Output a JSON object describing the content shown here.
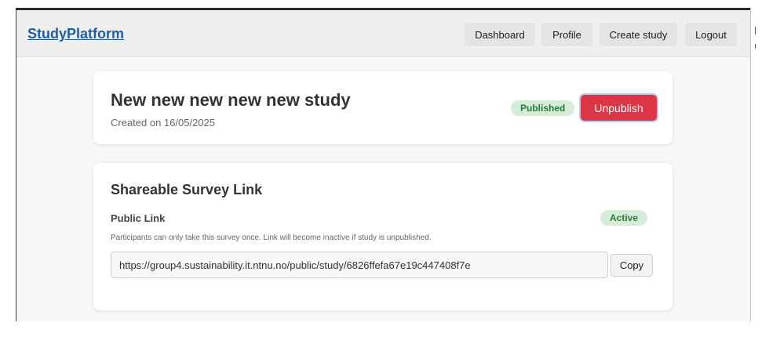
{
  "navbar": {
    "brand": "StudyPlatform",
    "buttons": {
      "dashboard": "Dashboard",
      "profile": "Profile",
      "create_study": "Create study",
      "logout": "Logout"
    }
  },
  "study": {
    "title": "New new new new new study",
    "created": "Created on 16/05/2025",
    "status_badge": "Published",
    "unpublish_label": "Unpublish"
  },
  "share": {
    "heading": "Shareable Survey Link",
    "public_link_label": "Public Link",
    "link_status": "Active",
    "note": "Participants can only take this survey once. Link will become inactive if study is unpublished.",
    "url": "https://group4.sustainability.it.ntnu.no/public/study/6826ffefa67e19c447408f7e",
    "copy_label": "Copy"
  },
  "colors": {
    "brand": "#1f5fa8",
    "danger": "#dc3545",
    "success_bg": "#d5ecd9",
    "success_text": "#2a7a3b"
  }
}
